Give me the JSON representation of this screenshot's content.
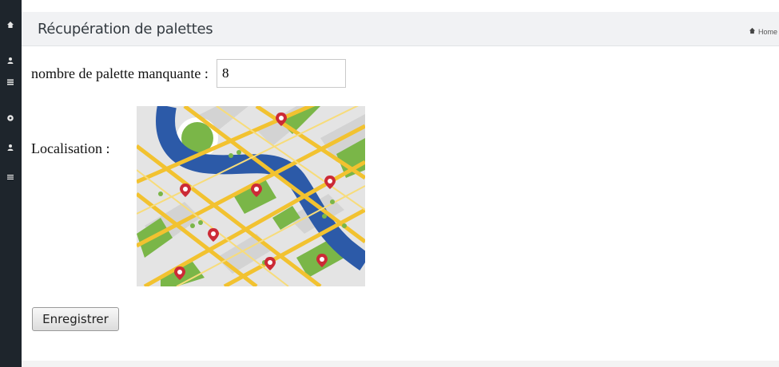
{
  "sidebar": {
    "icons": [
      "home-icon",
      "user-icon",
      "list-icon",
      "circle-icon",
      "user-icon",
      "menu-icon"
    ]
  },
  "header": {
    "title": "Récupération de palettes",
    "breadcrumb": "Home"
  },
  "form": {
    "count_label": "nombre de palette manquante :",
    "count_value": "8",
    "location_label": "Localisation :",
    "save_label": "Enregistrer"
  },
  "colors": {
    "sidebar": "#1e252c",
    "header_bg": "#f1f2f4",
    "river": "#2c5aa8",
    "road": "#f2c230",
    "park": "#7ab648",
    "pin": "#cc2a36"
  }
}
